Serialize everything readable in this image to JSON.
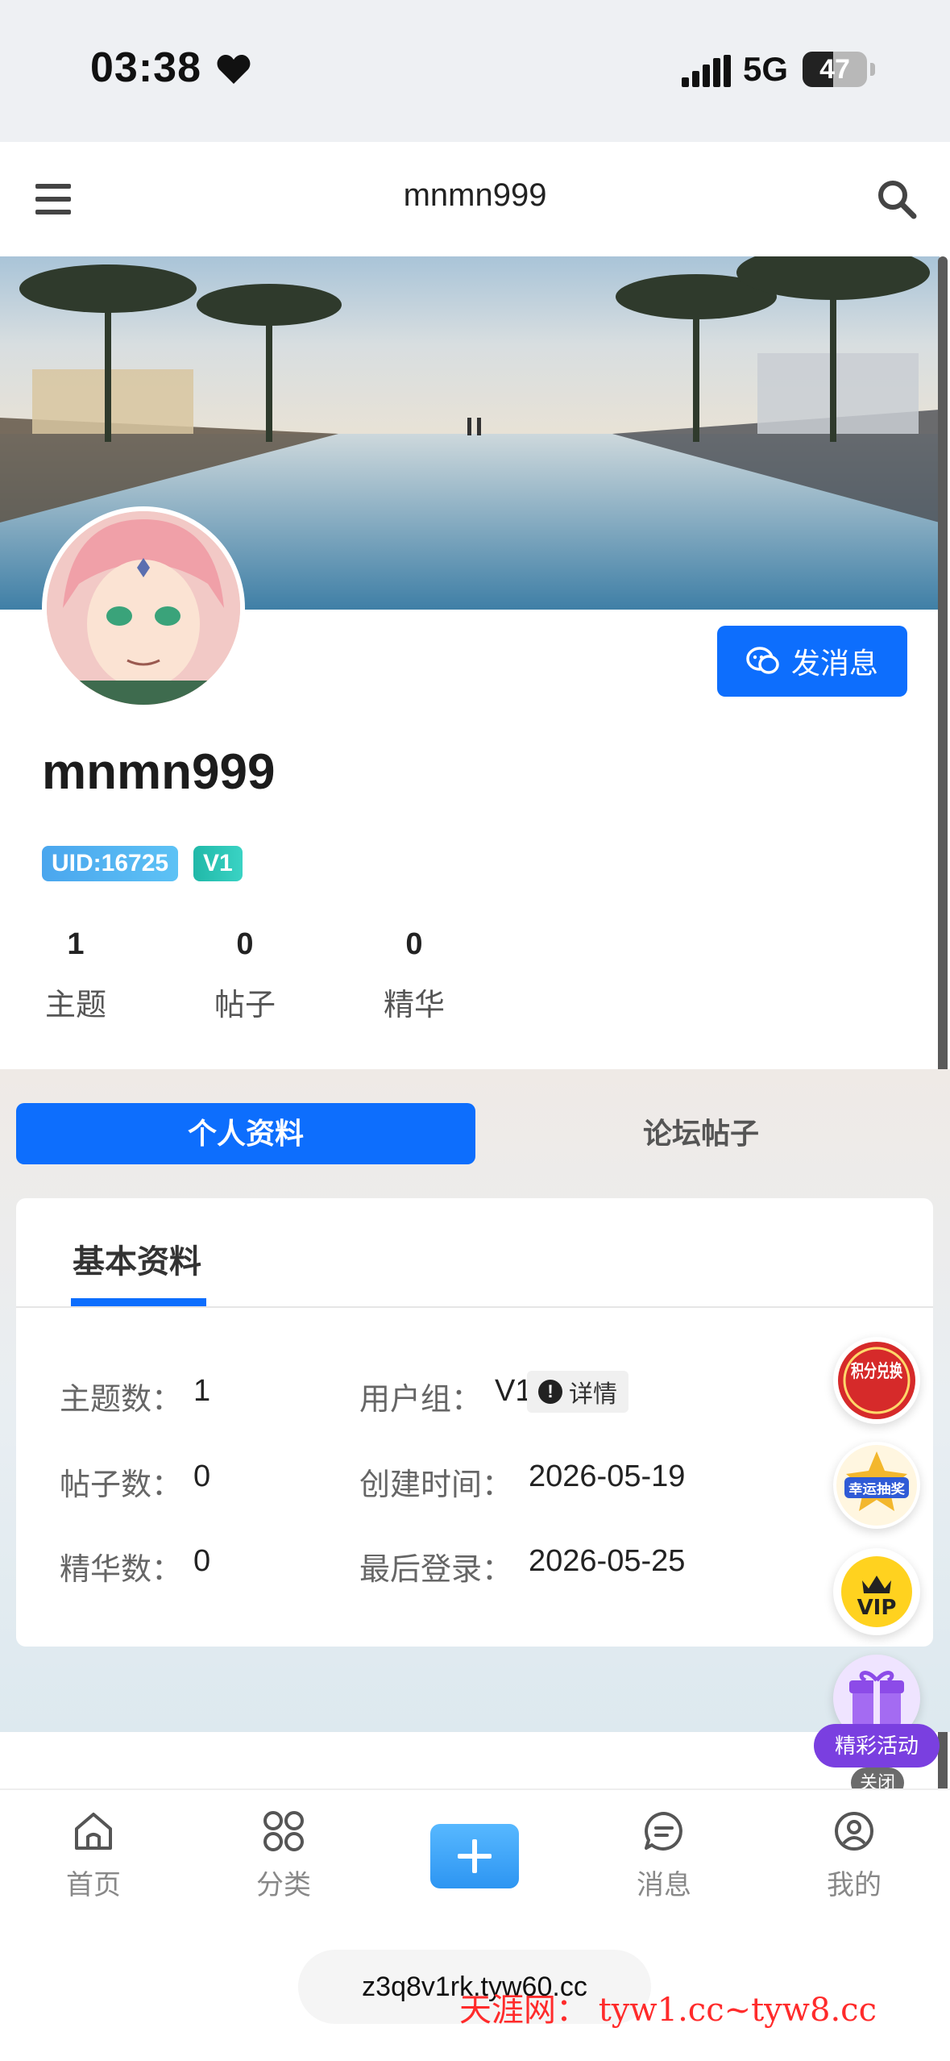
{
  "status_bar": {
    "time": "03:38",
    "network": "5G",
    "battery": "47",
    "battery_level": 0.47
  },
  "header": {
    "title": "mnmn999",
    "menu_icon": "hamburger-icon",
    "search_icon": "search-icon"
  },
  "profile": {
    "username": "mnmn999",
    "uid_badge": "UID:16725",
    "level_badge": "V1",
    "message_button": "发消息",
    "stats": [
      {
        "value": "1",
        "label": "主题"
      },
      {
        "value": "0",
        "label": "帖子"
      },
      {
        "value": "0",
        "label": "精华"
      }
    ]
  },
  "tabs": {
    "active": "个人资料",
    "inactive": "论坛帖子"
  },
  "basic_info": {
    "title": "基本资料",
    "topics_label": "主题数：",
    "topics_value": "1",
    "posts_label": "帖子数：",
    "posts_value": "0",
    "essence_label": "精华数：",
    "essence_value": "0",
    "group_label": "用户组：",
    "group_value": "V1",
    "detail_label": "详情",
    "created_label": "创建时间：",
    "created_value": "2026-05-19",
    "last_login_label": "最后登录：",
    "last_login_value": "2026-05-25"
  },
  "floating": {
    "points_badge": "积分兑换",
    "lottery_badge": "幸运抽奖",
    "vip_badge": "VIP",
    "activity_label": "精彩活动",
    "close_label": "关闭"
  },
  "bottom_nav": [
    {
      "label": "首页",
      "icon": "home-icon"
    },
    {
      "label": "分类",
      "icon": "category-icon"
    },
    {
      "label": "消息",
      "icon": "message-icon"
    },
    {
      "label": "我的",
      "icon": "user-icon"
    }
  ],
  "url_bar": "z3q8v1rk.tyw60.cc",
  "watermark": "天涯网： tyw1.cc~tyw8.cc",
  "colors": {
    "primary": "#0d6efd",
    "activity": "#7a3fe0"
  }
}
